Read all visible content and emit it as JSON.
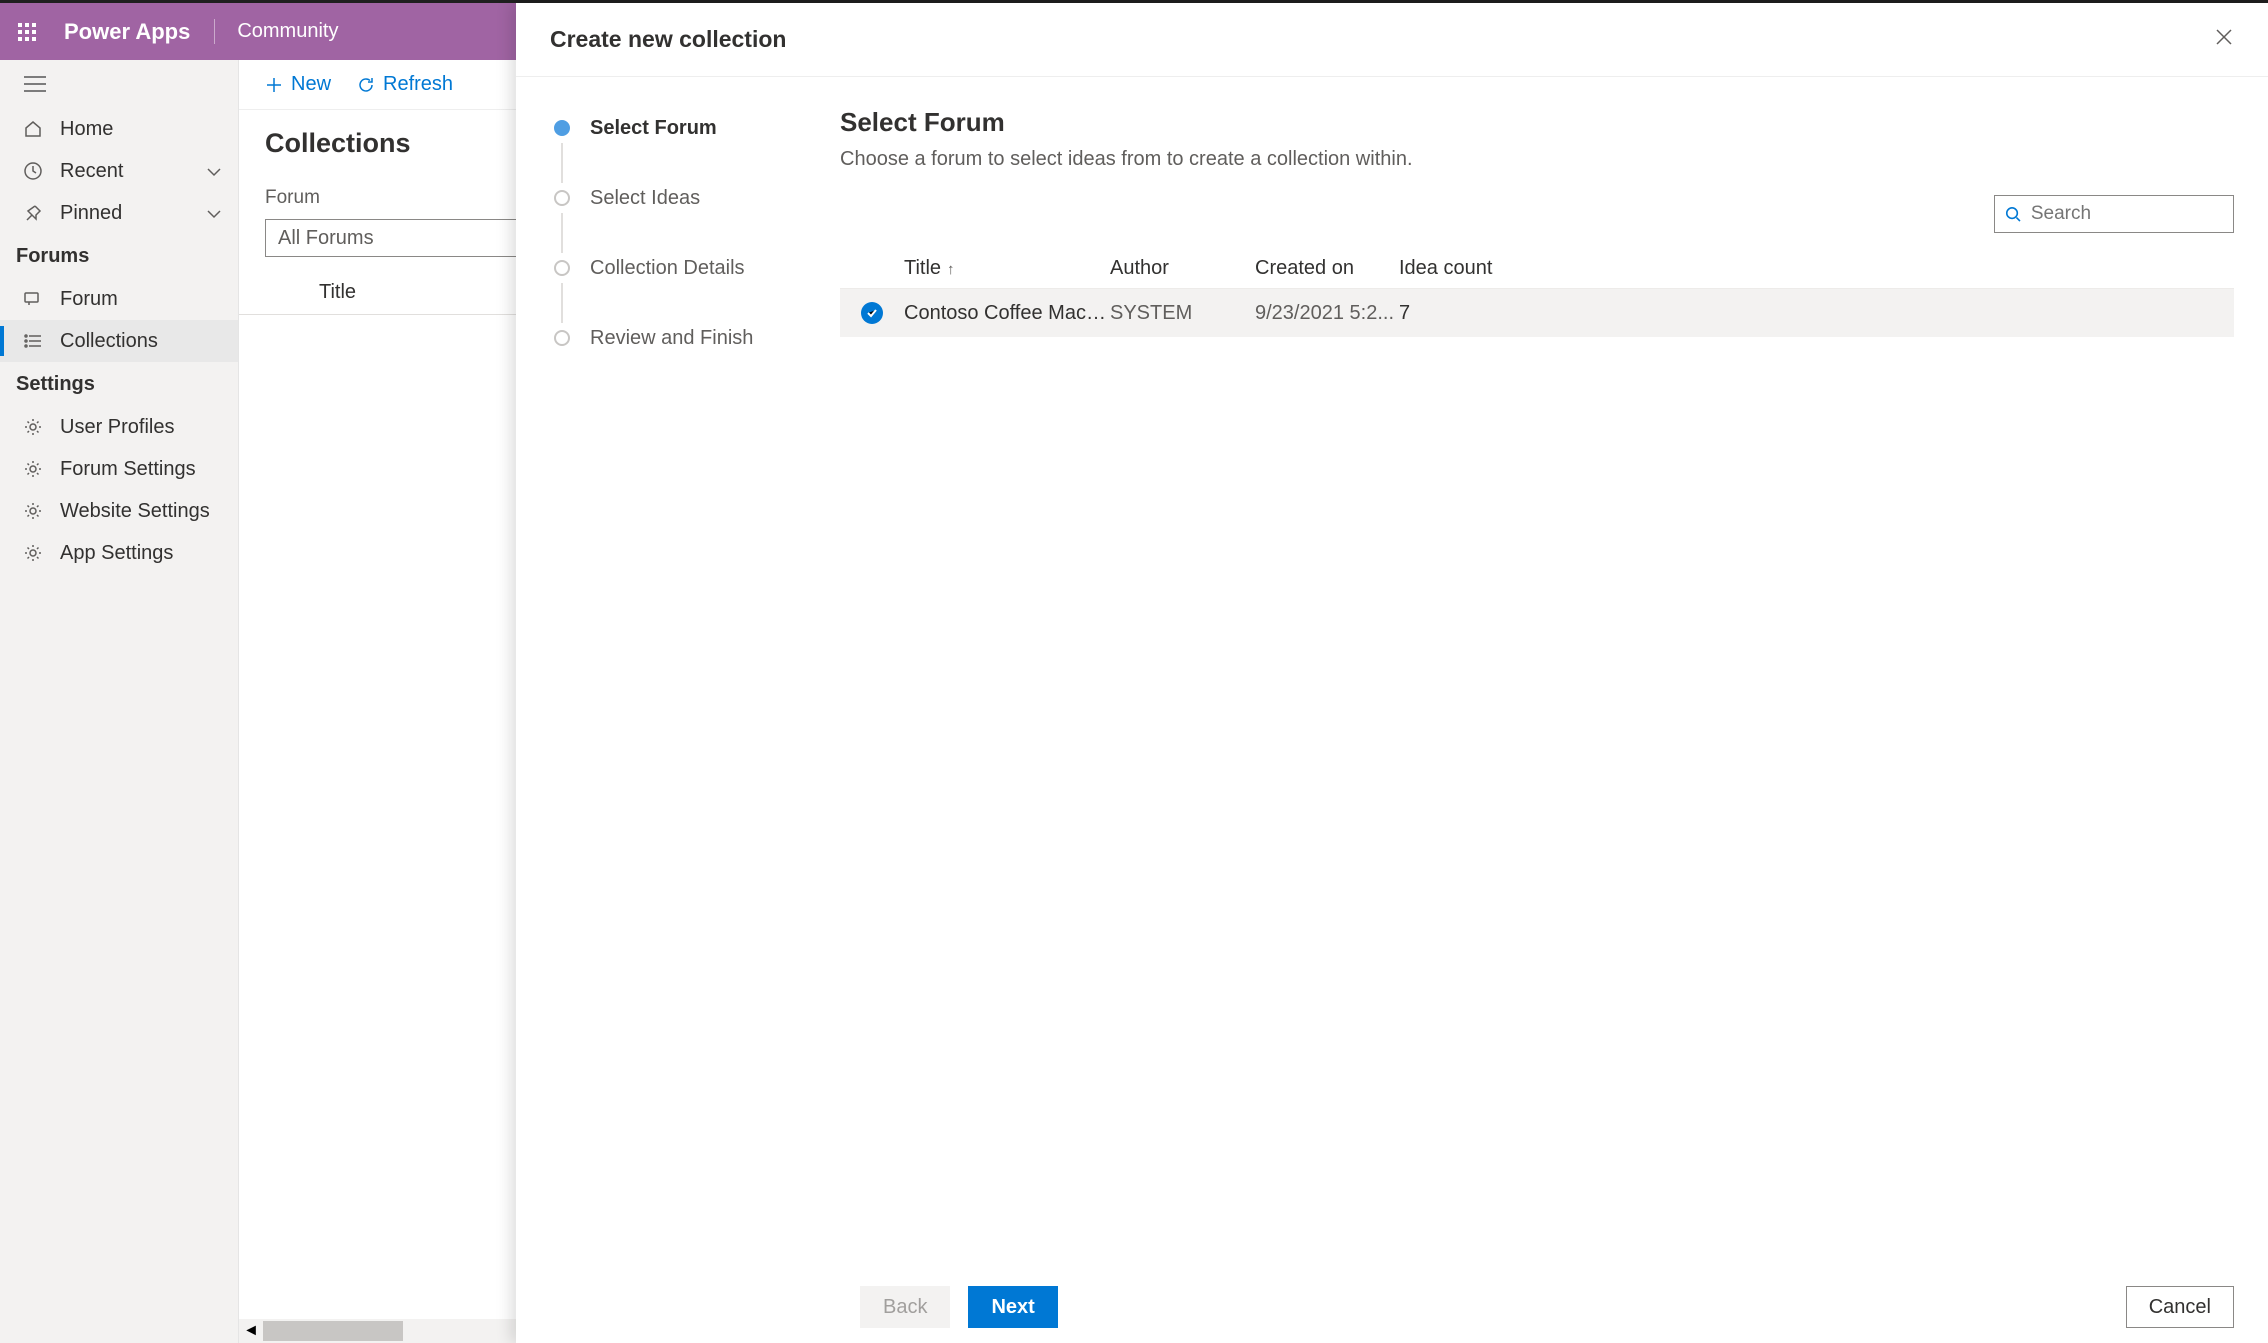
{
  "header": {
    "brand": "Power Apps",
    "context": "Community"
  },
  "leftnav": {
    "home": "Home",
    "recent": "Recent",
    "pinned": "Pinned",
    "section_forums": "Forums",
    "forum": "Forum",
    "collections": "Collections",
    "section_settings": "Settings",
    "user_profiles": "User Profiles",
    "forum_settings": "Forum Settings",
    "website_settings": "Website Settings",
    "app_settings": "App Settings"
  },
  "toolbar": {
    "new": "New",
    "refresh": "Refresh"
  },
  "list": {
    "title": "Collections",
    "filter_label": "Forum",
    "filter_value": "All Forums",
    "col_title": "Title"
  },
  "panel": {
    "title": "Create new collection",
    "steps": [
      "Select Forum",
      "Select Ideas",
      "Collection Details",
      "Review and Finish"
    ],
    "step_title": "Select Forum",
    "step_subtitle": "Choose a forum to select ideas from to create a collection within.",
    "search_placeholder": "Search",
    "cols": {
      "title": "Title",
      "author": "Author",
      "created": "Created on",
      "ideacount": "Idea count"
    },
    "rows": [
      {
        "title": "Contoso Coffee Mach...",
        "author": "SYSTEM",
        "created": "9/23/2021 5:2...",
        "ideacount": "7"
      }
    ],
    "buttons": {
      "back": "Back",
      "next": "Next",
      "cancel": "Cancel"
    }
  }
}
